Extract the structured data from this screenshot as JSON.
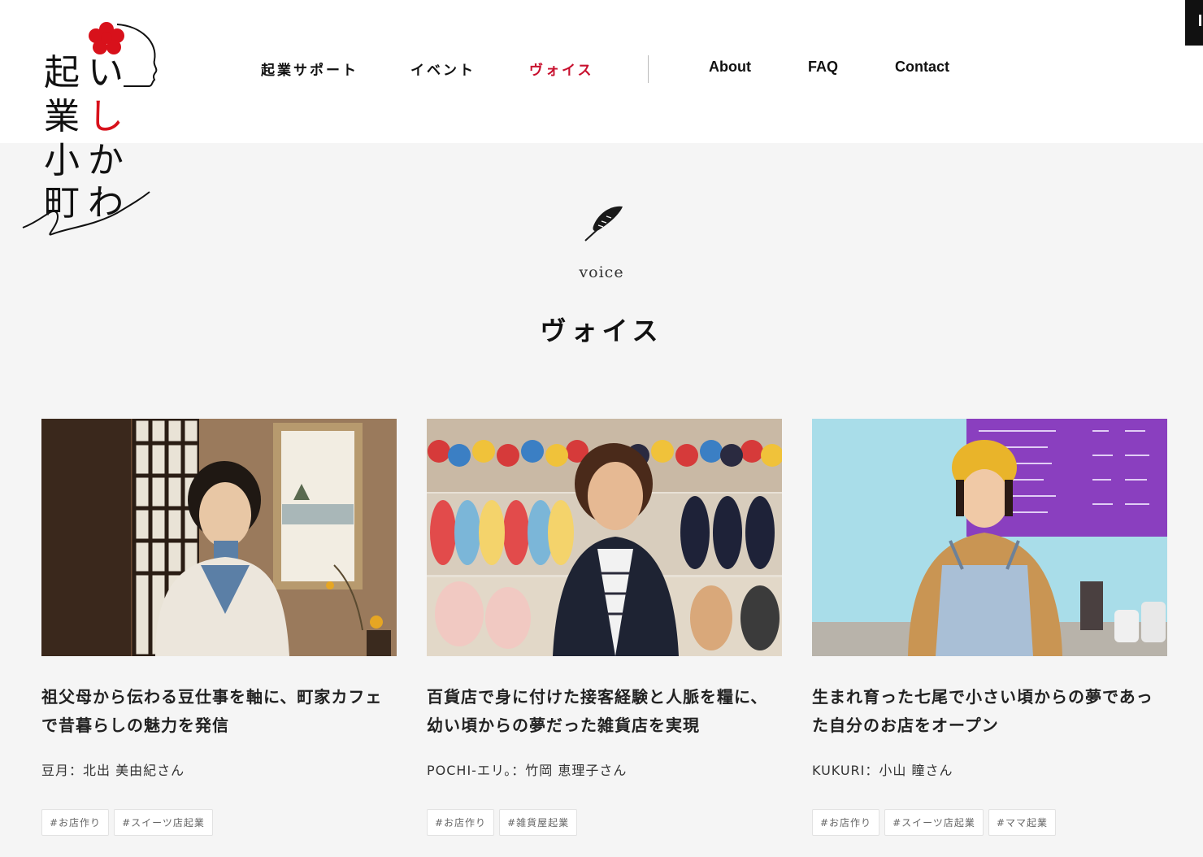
{
  "logo": {
    "chars_left": [
      "起",
      "業",
      "小",
      "町"
    ],
    "chars_right": [
      "い",
      "し",
      "か",
      "わ"
    ],
    "red_color": "#d8111b"
  },
  "nav": {
    "items": [
      {
        "label": "起業サポート",
        "active": false
      },
      {
        "label": "イベント",
        "active": false
      },
      {
        "label": "ヴォイス",
        "active": true
      },
      {
        "label": "About",
        "active": false
      },
      {
        "label": "FAQ",
        "active": false
      },
      {
        "label": "Contact",
        "active": false
      }
    ],
    "active_color": "#c8102e"
  },
  "section": {
    "icon": "feather-icon",
    "label_en": "voice",
    "title": "ヴォイス"
  },
  "cards": [
    {
      "title": "祖父母から伝わる豆仕事を軸に、町家カフェで昔暮らしの魅力を発信",
      "author": "豆月：北出 美由紀さん",
      "tags": [
        "#お店作り",
        "#スイーツ店起業"
      ]
    },
    {
      "title": "百貨店で身に付けた接客経験と人脈を糧に、幼い頃からの夢だった雑貨店を実現",
      "author": "POCHI-エリ。：竹岡 恵理子さん",
      "tags": [
        "#お店作り",
        "#雑貨屋起業"
      ]
    },
    {
      "title": "生まれ育った七尾で小さい頃からの夢であった自分のお店をオープン",
      "author": "KUKURI：小山 瞳さん",
      "tags": [
        "#お店作り",
        "#スイーツ店起業",
        "#ママ起業"
      ]
    }
  ]
}
